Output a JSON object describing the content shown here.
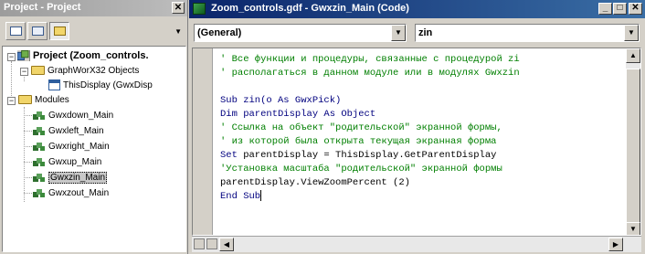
{
  "project": {
    "title": "Project - Project",
    "close_glyph": "✕",
    "tree": {
      "root_label": "Project (Zoom_controls.",
      "objects_folder": "GraphWorX32 Objects",
      "this_display": "ThisDisplay (GwxDisp",
      "modules_folder": "Modules",
      "modules": [
        "Gwxdown_Main",
        "Gwxleft_Main",
        "Gwxright_Main",
        "Gwxup_Main",
        "Gwxzin_Main",
        "Gwxzout_Main"
      ],
      "selected_index": 4
    }
  },
  "code_window": {
    "title": "Zoom_controls.gdf - Gwxzin_Main (Code)",
    "object_combo": "(General)",
    "proc_combo": "zin",
    "buttons": {
      "minimize": "_",
      "maximize": "□",
      "close": "✕"
    },
    "lines": [
      {
        "kind": "cm",
        "text": "' Все функции и процедуры, связанные с процедурой zi"
      },
      {
        "kind": "cm",
        "text": "' располагаться в данном модуле или в модулях Gwxzin"
      },
      {
        "kind": "tx",
        "text": ""
      },
      {
        "kind": "kw",
        "text": "Sub zin(o As GwxPick)"
      },
      {
        "kind": "kw",
        "text": "Dim parentDisplay As Object"
      },
      {
        "kind": "cm",
        "text": "' Ссылка на объект \"родительской\" экранной формы,"
      },
      {
        "kind": "cm",
        "text": "' из которой была открыта текущая экранная форма"
      },
      {
        "kind": "tx",
        "text": "Set parentDisplay = ThisDisplay.GetParentDisplay"
      },
      {
        "kind": "cm",
        "text": "'Установка масштаба \"родительской\" экранной формы"
      },
      {
        "kind": "tx",
        "text": "parentDisplay.ViewZoomPercent (2)"
      },
      {
        "kind": "kw",
        "text": "End Sub"
      }
    ]
  },
  "colors": {
    "keyword": "#00007f",
    "comment": "#007f00",
    "active_title": "#0a246a",
    "inactive_title": "#9c9c9c"
  }
}
